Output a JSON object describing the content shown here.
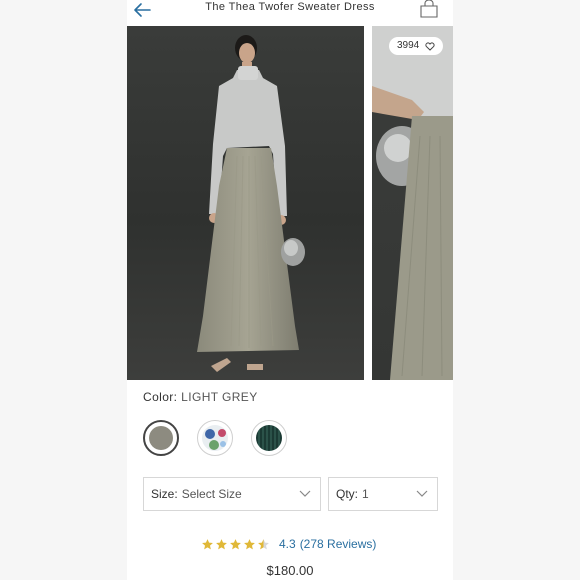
{
  "header": {
    "title": "The Thea Twofer Sweater Dress",
    "back_icon": "arrow-left-icon",
    "bag_icon": "shopping-bag-icon"
  },
  "gallery": {
    "likes_count": "3994",
    "like_icon": "heart-icon"
  },
  "color": {
    "label": "Color:",
    "selected_value": "LIGHT GREY",
    "swatches": [
      {
        "name": "light grey",
        "color": "#8d8b80",
        "selected": true
      },
      {
        "name": "floral",
        "color": "#e9eef1",
        "selected": false
      },
      {
        "name": "dark green",
        "color": "#203f39",
        "selected": false
      }
    ]
  },
  "size_select": {
    "label": "Size:",
    "value": "Select Size"
  },
  "qty_select": {
    "label": "Qty:",
    "value": "1"
  },
  "reviews": {
    "stars": 4.3,
    "rating": "4.3",
    "count_text": "(278 Reviews)",
    "star_color": "#e0b838"
  },
  "price": "$180.00",
  "accent_color": "#2a6fa0"
}
